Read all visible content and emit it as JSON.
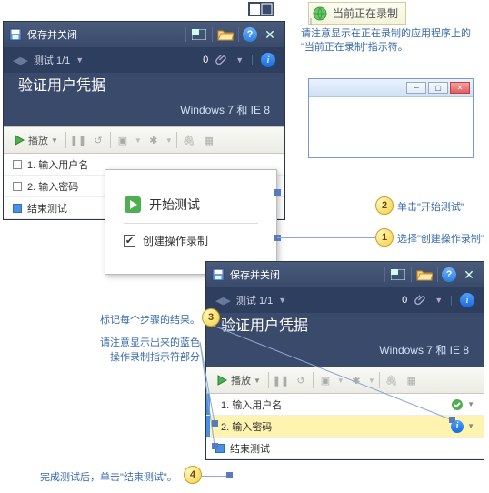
{
  "panel_a": {
    "titlebar": {
      "save_close": "保存并关闭"
    },
    "test_counter": "测试 1/1",
    "zero": "0",
    "title": "验证用户凭据",
    "subtitle": "Windows 7 和 IE 8",
    "toolbar": {
      "play": "播放"
    },
    "steps": [
      {
        "label": "1. 输入用户名"
      },
      {
        "label": "2. 输入密码"
      },
      {
        "label": "结束测试"
      }
    ]
  },
  "popup": {
    "start_test": "开始测试",
    "create_recording": "创建操作录制"
  },
  "rec_banner": "当前正在录制",
  "help_rec": "请注意显示在正在录制的应用程序上的\n\"当前正在录制\"指示符。",
  "callouts": {
    "c1": "选择\"创建操作录制\"",
    "c2": "单击\"开始测试\"",
    "c3_a": "标记每个步骤的结果。",
    "c3_b": "请注意显示出来的蓝色\n操作录制指示符部分",
    "c4": "完成测试后，单击\"结束测试\"。"
  },
  "panel_b": {
    "titlebar": {
      "save_close": "保存并关闭"
    },
    "test_counter": "测试 1/1",
    "zero": "0",
    "title": "验证用户凭据",
    "subtitle": "Windows 7 和 IE 8",
    "toolbar": {
      "play": "播放"
    },
    "steps": [
      {
        "label": "1. 输入用户名"
      },
      {
        "label": "2. 输入密码"
      },
      {
        "label": "结束测试"
      }
    ]
  }
}
